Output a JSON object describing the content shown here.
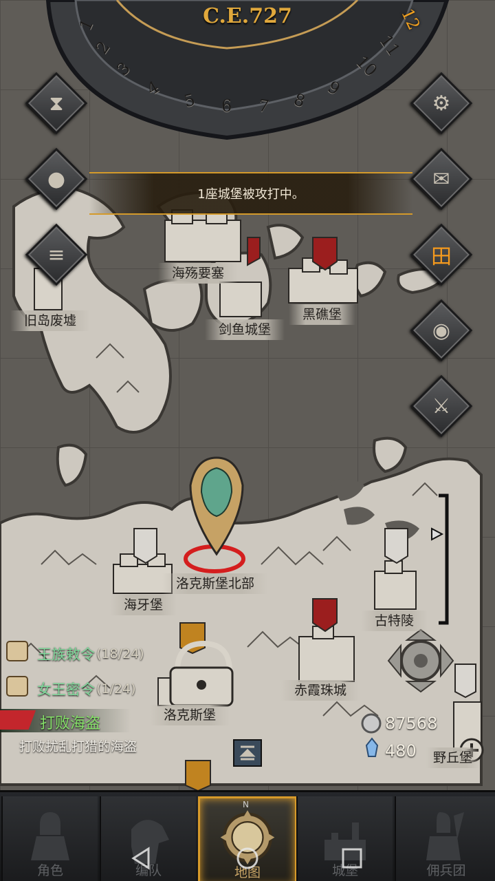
{
  "calendar": {
    "era": "C.E.727",
    "numbers": [
      "1",
      "2",
      "3",
      "4",
      "5",
      "6",
      "7",
      "8",
      "9",
      "10",
      "11",
      "12"
    ],
    "active_number": "12"
  },
  "banner": {
    "text": "1座城堡被攻打中。"
  },
  "side_buttons": {
    "left": [
      {
        "icon": "hourglass-icon"
      },
      {
        "icon": "money-bag-icon"
      },
      {
        "icon": "scroll-icon"
      }
    ],
    "right": [
      {
        "icon": "gear-icon"
      },
      {
        "icon": "mail-icon"
      },
      {
        "icon": "grid-window-icon"
      },
      {
        "icon": "coin-icon"
      },
      {
        "icon": "helmet-sword-icon"
      }
    ]
  },
  "locations": {
    "haishang": "海殇要塞",
    "jiudao": "旧岛废墟",
    "jianyu": "剑鱼城堡",
    "heijiao": "黑礁堡",
    "luoke_north": "洛克斯堡北部",
    "haiya": "海牙堡",
    "gute": "古特陵",
    "chixia": "赤霞珠城",
    "luoke": "洛克斯堡",
    "yequ": "野丘堡"
  },
  "quests": [
    {
      "title": "王族敕令",
      "count": "(18/24)"
    },
    {
      "title": "女王密令",
      "count": "(1/24)"
    }
  ],
  "active_quest": {
    "title": "打败海盗",
    "description": "打败扰乱打猎的海盗"
  },
  "resources": {
    "silver": "87568",
    "crystal": "480"
  },
  "nav": {
    "tabs": [
      {
        "label": "角色"
      },
      {
        "label": "编队"
      },
      {
        "label": "地图"
      },
      {
        "label": "城堡"
      },
      {
        "label": "佣兵团"
      }
    ],
    "compass_letter": "N"
  },
  "colors": {
    "accent": "#d79a2a",
    "quest_green": "#7fd69a",
    "pirate_red": "#c3262c"
  }
}
